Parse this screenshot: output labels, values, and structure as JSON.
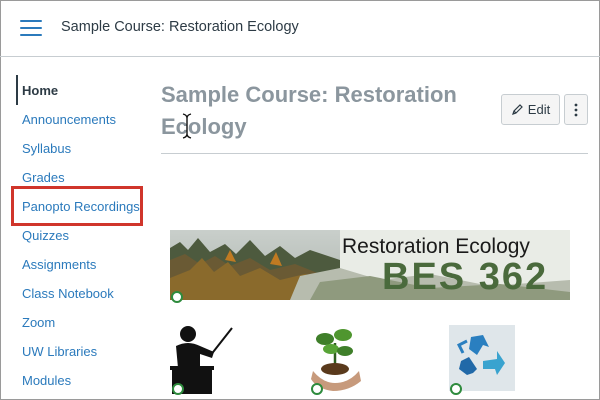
{
  "header": {
    "breadcrumb": "Sample Course: Restoration Ecology"
  },
  "sidebar": {
    "items": [
      {
        "label": "Home",
        "active": true
      },
      {
        "label": "Announcements"
      },
      {
        "label": "Syllabus"
      },
      {
        "label": "Grades"
      },
      {
        "label": "Panopto Recordings",
        "highlighted": true
      },
      {
        "label": "Quizzes"
      },
      {
        "label": "Assignments"
      },
      {
        "label": "Class Notebook"
      },
      {
        "label": "Zoom"
      },
      {
        "label": "UW Libraries"
      },
      {
        "label": "Modules"
      }
    ]
  },
  "main": {
    "title": "Sample Course: Restoration Ecology",
    "edit_label": "Edit",
    "banner": {
      "title": "Restoration Ecology",
      "code": "BES 362"
    }
  },
  "colors": {
    "link": "#2b7abc",
    "highlight": "#d0352b",
    "title": "#8b969e"
  }
}
